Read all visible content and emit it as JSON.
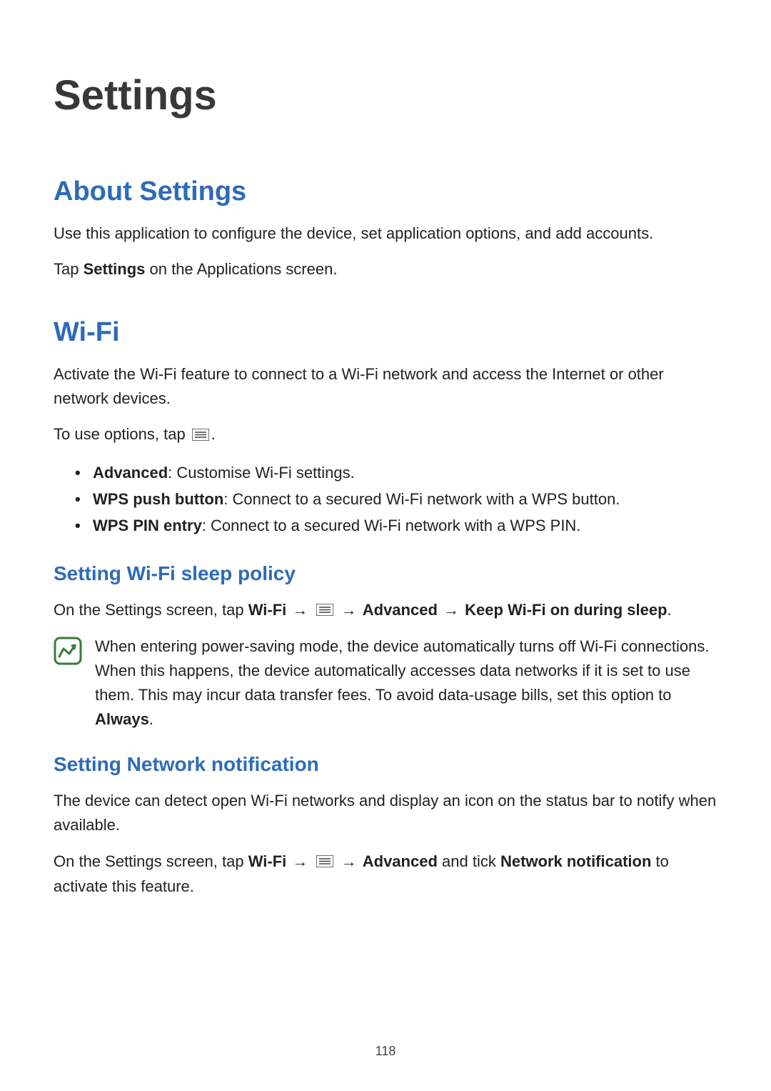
{
  "page": {
    "title": "Settings",
    "number": "118"
  },
  "about": {
    "heading": "About Settings",
    "line1": "Use this application to configure the device, set application options, and add accounts.",
    "line2_prefix": "Tap ",
    "line2_bold": "Settings",
    "line2_suffix": " on the Applications screen."
  },
  "wifi": {
    "heading": "Wi-Fi",
    "intro": "Activate the Wi-Fi feature to connect to a Wi-Fi network and access the Internet or other network devices.",
    "options_prefix": "To use options, tap ",
    "options_suffix": ".",
    "bullets": [
      {
        "bold": "Advanced",
        "rest": ": Customise Wi-Fi settings."
      },
      {
        "bold": "WPS push button",
        "rest": ": Connect to a secured Wi-Fi network with a WPS button."
      },
      {
        "bold": "WPS PIN entry",
        "rest": ": Connect to a secured Wi-Fi network with a WPS PIN."
      }
    ],
    "sleep": {
      "heading": "Setting Wi-Fi sleep policy",
      "line_prefix": "On the Settings screen, tap ",
      "b1": "Wi-Fi",
      "arrow": " → ",
      "b2": "Advanced",
      "b3": "Keep Wi-Fi on during sleep",
      "suffix": ".",
      "note_part1": "When entering power-saving mode, the device automatically turns off Wi-Fi connections. When this happens, the device automatically accesses data networks if it is set to use them. This may incur data transfer fees. To avoid data-usage bills, set this option to ",
      "note_bold": "Always",
      "note_part2": "."
    },
    "network": {
      "heading": "Setting Network notification",
      "intro": "The device can detect open Wi-Fi networks and display an icon on the status bar to notify when available.",
      "line_prefix": "On the Settings screen, tap ",
      "b1": "Wi-Fi",
      "arrow": " → ",
      "b2": "Advanced",
      "mid": " and tick ",
      "b3": "Network notification",
      "suffix": " to activate this feature."
    }
  }
}
